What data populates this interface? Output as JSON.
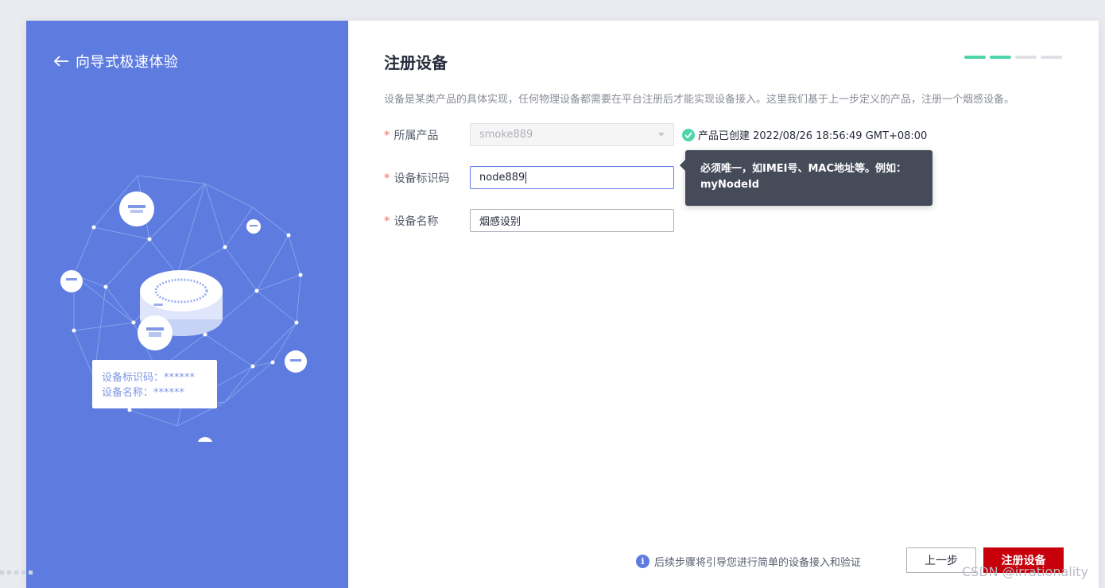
{
  "wizard": {
    "back_label": "向导式极速体验",
    "illustration": {
      "card_line1": "设备标识码：******",
      "card_line2": "设备名称：******"
    }
  },
  "main": {
    "title": "注册设备",
    "steps": {
      "total": 4,
      "completed": 2
    },
    "description": "设备是某类产品的具体实现，任何物理设备都需要在平台注册后才能实现设备接入。这里我们基于上一步定义的产品，注册一个烟感设备。",
    "form": {
      "product": {
        "label": "所属产品",
        "value": "smoke889",
        "status_text": "产品已创建 2022/08/26 18:56:49 GMT+08:00"
      },
      "node_id": {
        "label": "设备标识码",
        "value": "node889",
        "tooltip": "必须唯一，如IMEI号、MAC地址等。例如：myNodeId"
      },
      "device_name": {
        "label": "设备名称",
        "value": "烟感设别"
      }
    },
    "footer": {
      "tip": "后续步骤将引导您进行简单的设备接入和验证",
      "prev_label": "上一步",
      "submit_label": "注册设备"
    }
  },
  "watermark": "CSDN @irrationality",
  "colors": {
    "panel_blue": "#5e7ce0",
    "primary_red": "#c7000b",
    "success_green": "#50d4ab"
  }
}
